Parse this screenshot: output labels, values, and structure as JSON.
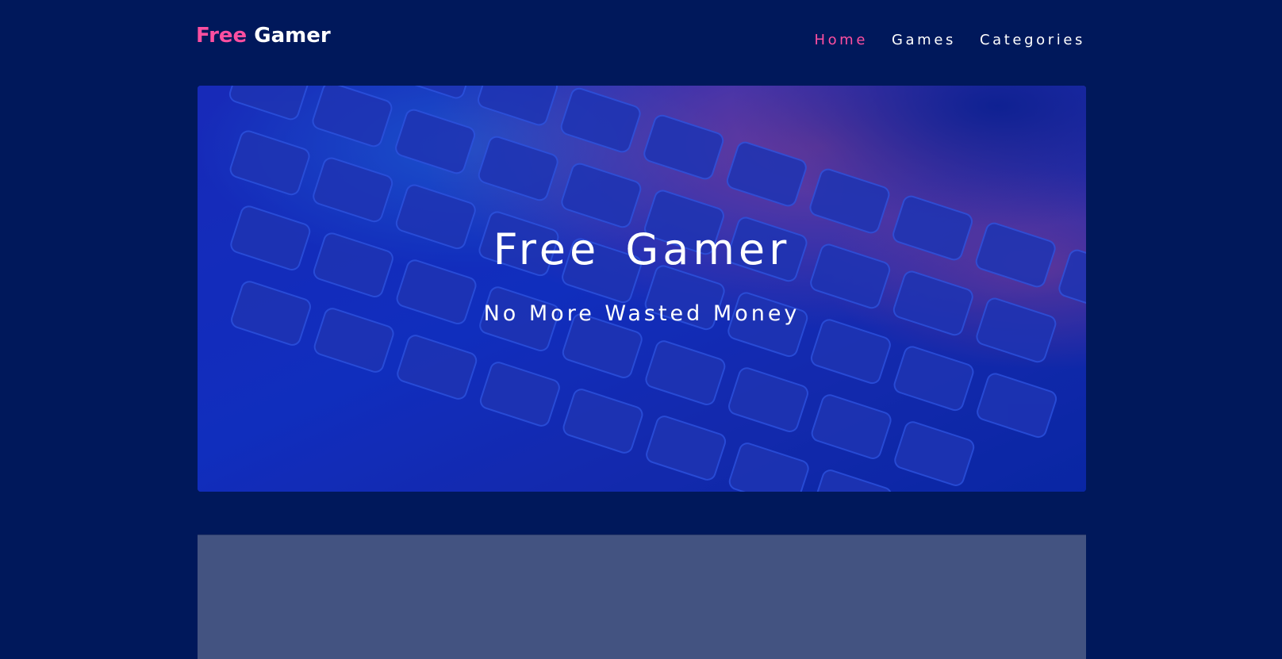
{
  "header": {
    "logo_part1": "Free",
    "logo_part2": "Gamer",
    "nav": [
      {
        "label": "Home",
        "active": true
      },
      {
        "label": "Games",
        "active": false
      },
      {
        "label": "Categories",
        "active": false
      }
    ]
  },
  "hero": {
    "title": "Free Gamer",
    "subtitle": "No More Wasted Money"
  },
  "colors": {
    "background": "#00185b",
    "accent": "#ff4fa0",
    "panel": "#435381"
  }
}
